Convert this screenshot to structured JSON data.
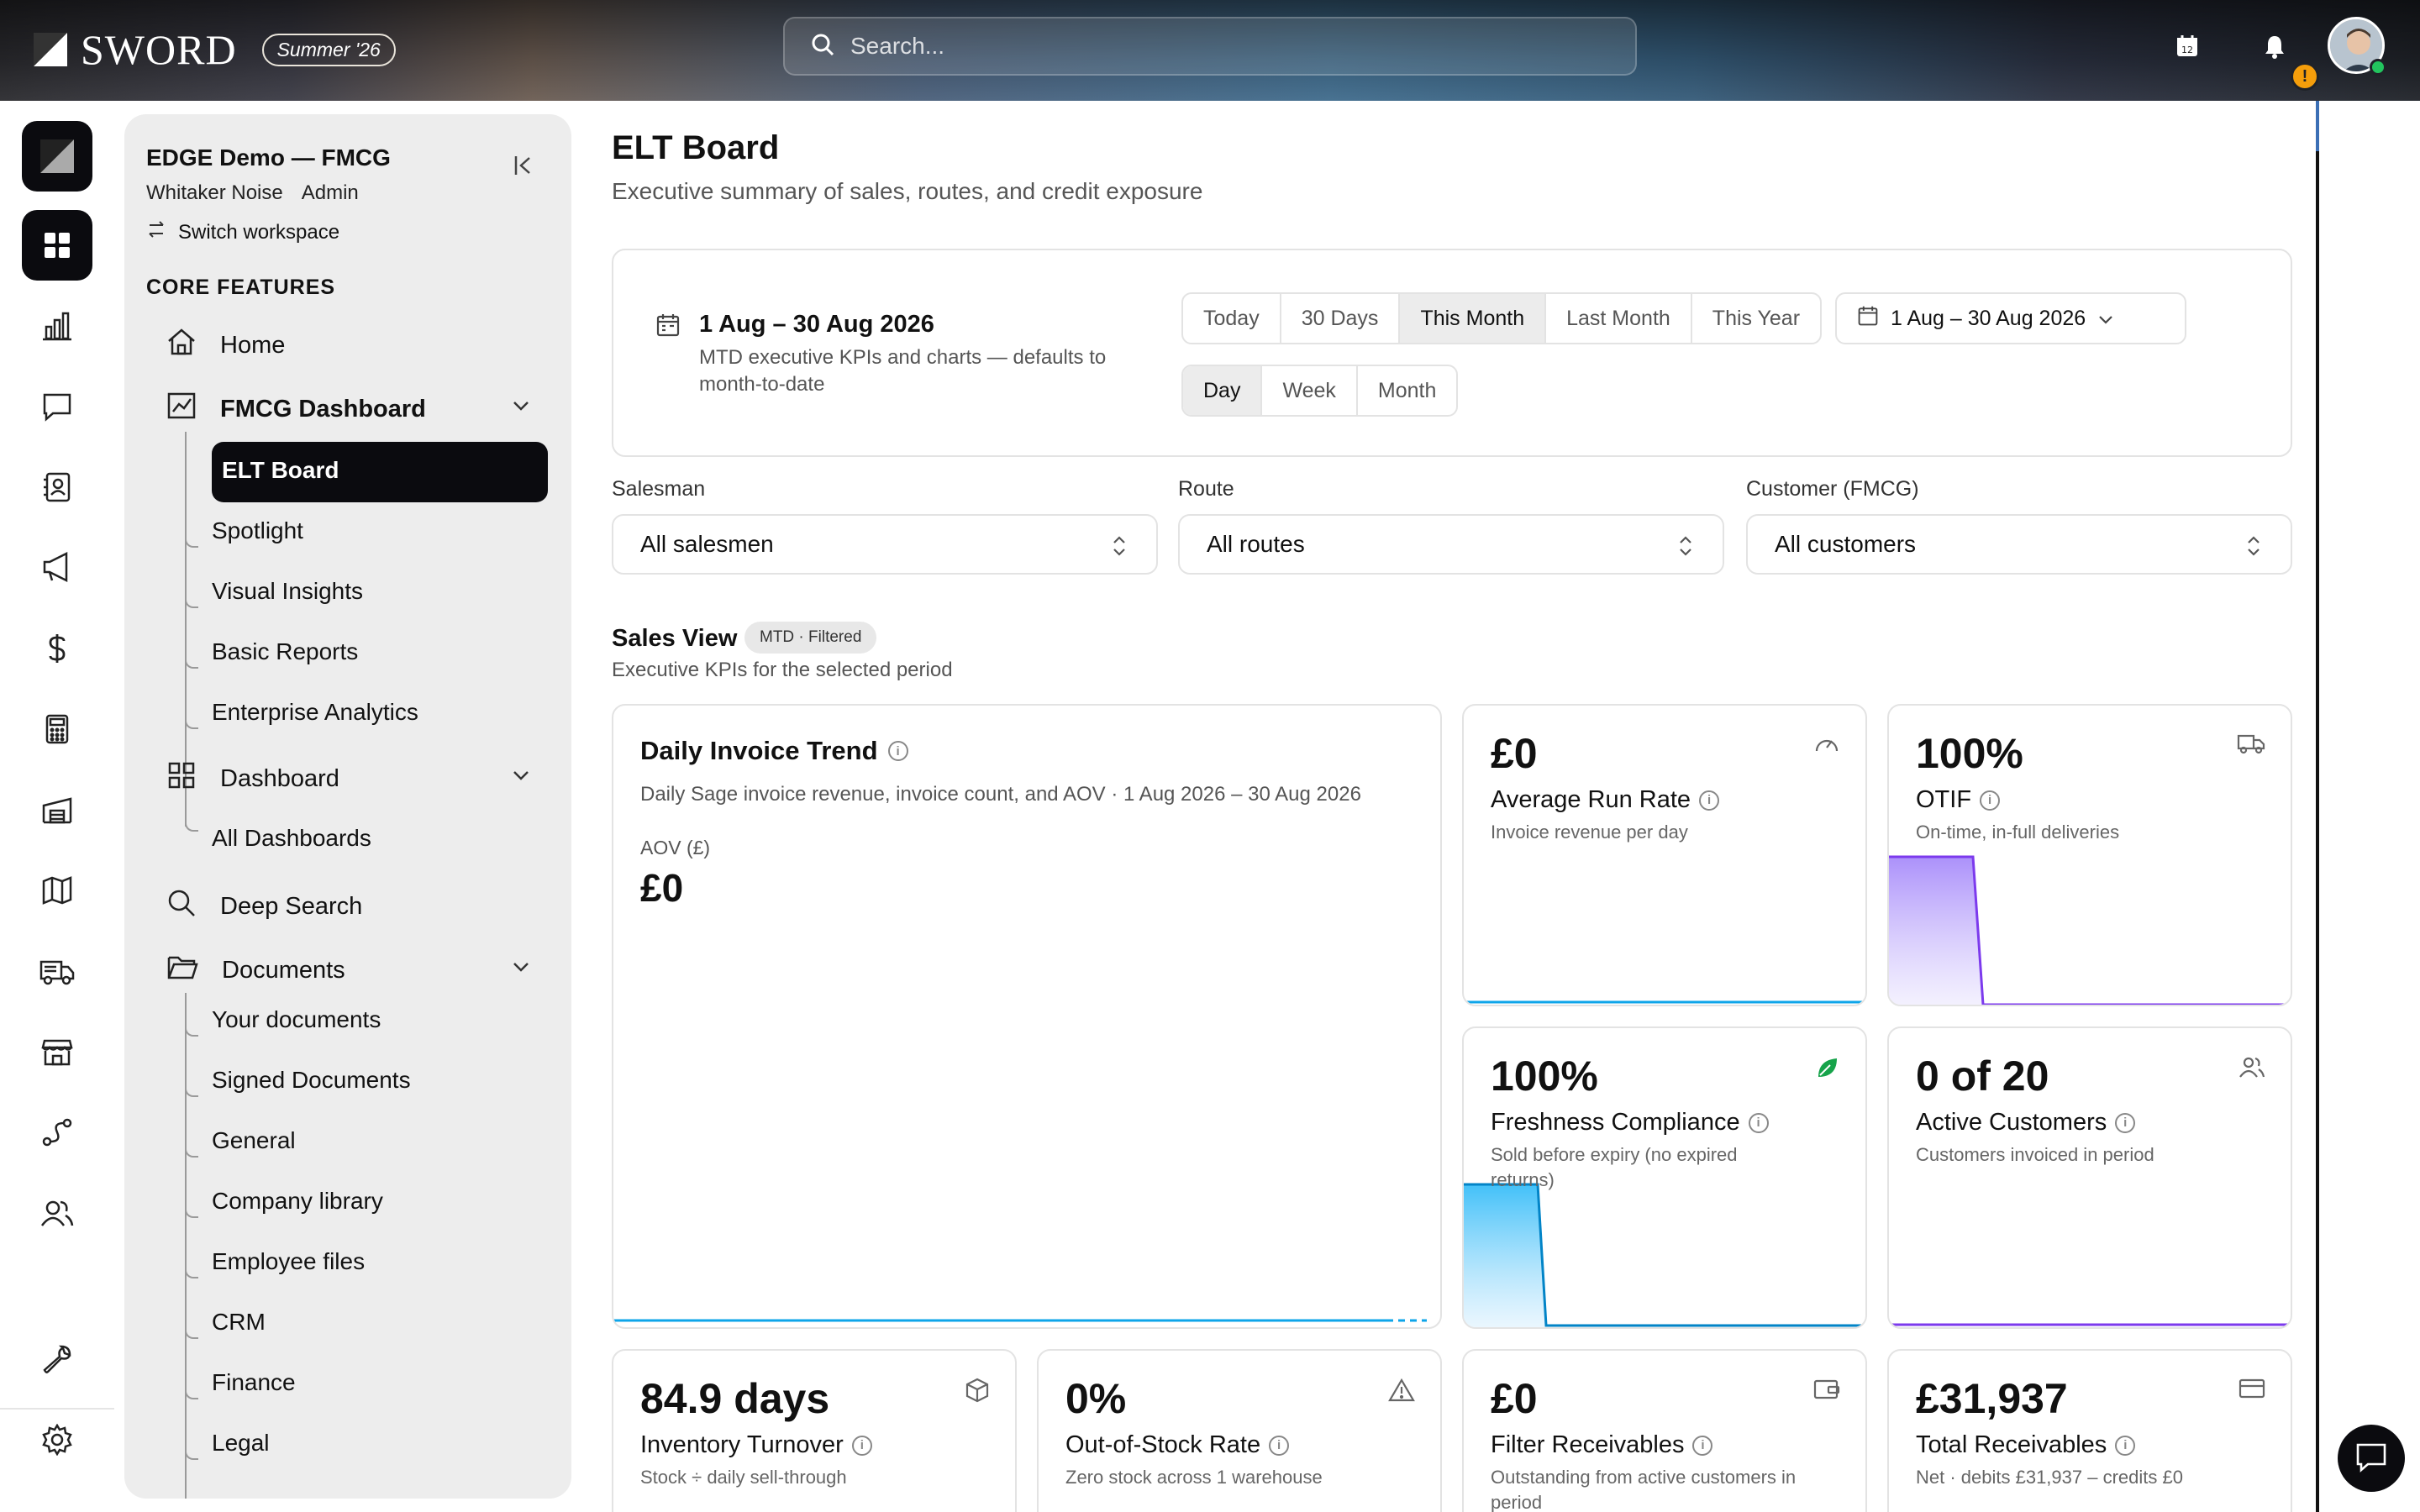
{
  "brand": {
    "name": "SWORD",
    "season_badge": "Summer '26"
  },
  "search": {
    "placeholder": "Search..."
  },
  "calendar_icon_day": "12",
  "alert_badge": "!",
  "workspace": {
    "name": "EDGE Demo — FMCG",
    "user": "Whitaker Noise",
    "role": "Admin",
    "switch_label": "Switch workspace"
  },
  "sidebar": {
    "section_label": "CORE FEATURES",
    "home": "Home",
    "fmcg_dashboard": "FMCG Dashboard",
    "fmcg_children": [
      "ELT Board",
      "Spotlight",
      "Visual Insights",
      "Basic Reports",
      "Enterprise Analytics"
    ],
    "dashboard": "Dashboard",
    "dashboard_children": [
      "All Dashboards"
    ],
    "deep_search": "Deep Search",
    "documents": "Documents",
    "documents_children": [
      "Your documents",
      "Signed Documents",
      "General",
      "Company library",
      "Employee files",
      "CRM",
      "Finance",
      "Legal"
    ]
  },
  "page": {
    "title": "ELT Board",
    "subtitle": "Executive summary of sales, routes, and credit exposure"
  },
  "date_card": {
    "title": "1 Aug – 30 Aug 2026",
    "description": "MTD executive KPIs and charts — defaults to month-to-date",
    "ranges": [
      "Today",
      "30 Days",
      "This Month",
      "Last Month",
      "This Year"
    ],
    "active_range": "This Month",
    "granularity": [
      "Day",
      "Week",
      "Month"
    ],
    "active_granularity": "Day",
    "picker_value": "1 Aug – 30 Aug 2026"
  },
  "filters": {
    "salesman": {
      "label": "Salesman",
      "value": "All salesmen"
    },
    "route": {
      "label": "Route",
      "value": "All routes"
    },
    "customer": {
      "label": "Customer (FMCG)",
      "value": "All customers"
    }
  },
  "sales_view": {
    "title": "Sales View",
    "badge": "MTD · Filtered",
    "subtitle": "Executive KPIs for the selected period"
  },
  "trend_card": {
    "title": "Daily Invoice Trend",
    "subtitle": "Daily Sage invoice revenue, invoice count, and AOV · 1 Aug 2026 – 30 Aug 2026",
    "aov_label": "AOV (£)",
    "aov_value": "£0"
  },
  "kpis": {
    "run_rate": {
      "value": "£0",
      "label": "Average Run Rate",
      "desc": "Invoice revenue per day"
    },
    "otif": {
      "value": "100%",
      "label": "OTIF",
      "desc": "On-time, in-full deliveries"
    },
    "freshness": {
      "value": "100%",
      "label": "Freshness Compliance",
      "desc": "Sold before expiry (no expired returns)"
    },
    "active_customers": {
      "value": "0 of 20",
      "label": "Active Customers",
      "desc": "Customers invoiced in period"
    },
    "inventory_turnover": {
      "value": "84.9 days",
      "label": "Inventory Turnover",
      "desc": "Stock ÷ daily sell-through"
    },
    "out_of_stock": {
      "value": "0%",
      "label": "Out-of-Stock Rate",
      "desc": "Zero stock across 1 warehouse"
    },
    "filter_receivables": {
      "value": "£0",
      "label": "Filter Receivables",
      "desc": "Outstanding from active customers in period"
    },
    "total_receivables": {
      "value": "£31,937",
      "label": "Total Receivables",
      "desc": "Net · debits £31,937 – credits £0"
    }
  },
  "colors": {
    "accent_dark": "#0b0b0f",
    "purple": "#7c3aed",
    "blue": "#0ea5e9",
    "green": "#16a34a"
  }
}
